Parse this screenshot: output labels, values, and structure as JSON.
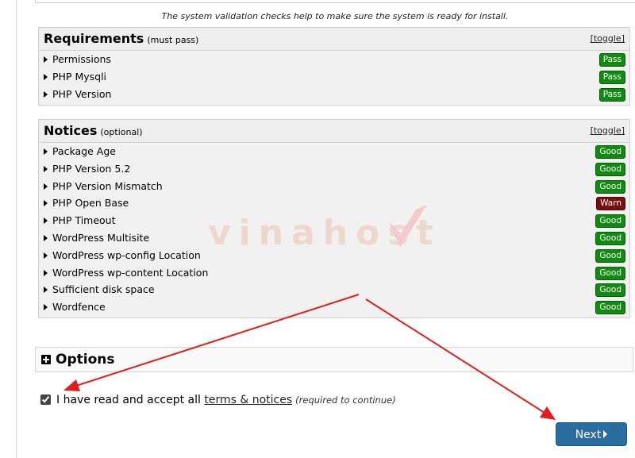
{
  "intro": "The system validation checks help to make sure the system is ready for install.",
  "requirements": {
    "title": "Requirements",
    "subtitle": "(must pass)",
    "toggle": "[toggle]",
    "items": [
      {
        "label": "Permissions",
        "status": "Pass"
      },
      {
        "label": "PHP Mysqli",
        "status": "Pass"
      },
      {
        "label": "PHP Version",
        "status": "Pass"
      }
    ]
  },
  "notices": {
    "title": "Notices",
    "subtitle": "(optional)",
    "toggle": "[toggle]",
    "items": [
      {
        "label": "Package Age",
        "status": "Good"
      },
      {
        "label": "PHP Version 5.2",
        "status": "Good"
      },
      {
        "label": "PHP Version Mismatch",
        "status": "Good"
      },
      {
        "label": "PHP Open Base",
        "status": "Warn"
      },
      {
        "label": "PHP Timeout",
        "status": "Good"
      },
      {
        "label": "WordPress Multisite",
        "status": "Good"
      },
      {
        "label": "WordPress wp-config Location",
        "status": "Good"
      },
      {
        "label": "WordPress wp-content Location",
        "status": "Good"
      },
      {
        "label": "Sufficient disk space",
        "status": "Good"
      },
      {
        "label": "Wordfence",
        "status": "Good"
      }
    ]
  },
  "options": {
    "title": "Options"
  },
  "accept": {
    "text": "I have read and accept all",
    "link": "terms & notices",
    "required": "(required to continue)",
    "checked": true
  },
  "next_label": "Next",
  "watermark": "vinahost",
  "colors": {
    "good": "#118a11",
    "warn": "#7a0d0d",
    "button": "#2a6da0",
    "arrow": "#e01e1e"
  }
}
